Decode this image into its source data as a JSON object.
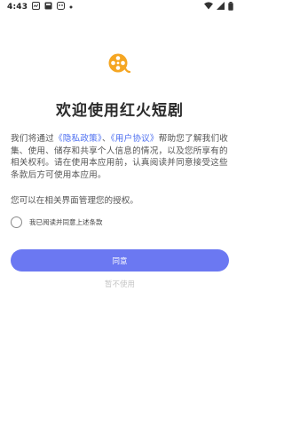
{
  "status_bar": {
    "time": "4:43"
  },
  "dialog": {
    "title": "欢迎使用红火短剧",
    "para_prefix": "我们将通过",
    "privacy_link": "《隐私政策》",
    "separator": "、",
    "agreement_link": "《用户协议》",
    "para_suffix": "帮助您了解我们收集、使用、储存和共享个人信息的情况，以及您所享有的相关权利。请在使用本应用前，认真阅读并同意接受这些条款后方可使用本应用。",
    "para2": "您可以在相关界面管理您的授权。",
    "agree_checkbox_label": "我已阅读并同意上述条款",
    "agree_button": "同意",
    "refuse_button": "暂不使用"
  },
  "colors": {
    "accent": "#6b78f2",
    "link": "#4c6ef0",
    "logo_orange": "#f5a623"
  },
  "icons": [
    "notification-icon",
    "sim-icon",
    "app-icon",
    "dot-icon",
    "wifi-icon",
    "signal-icon",
    "battery-icon",
    "film-reel-logo"
  ]
}
